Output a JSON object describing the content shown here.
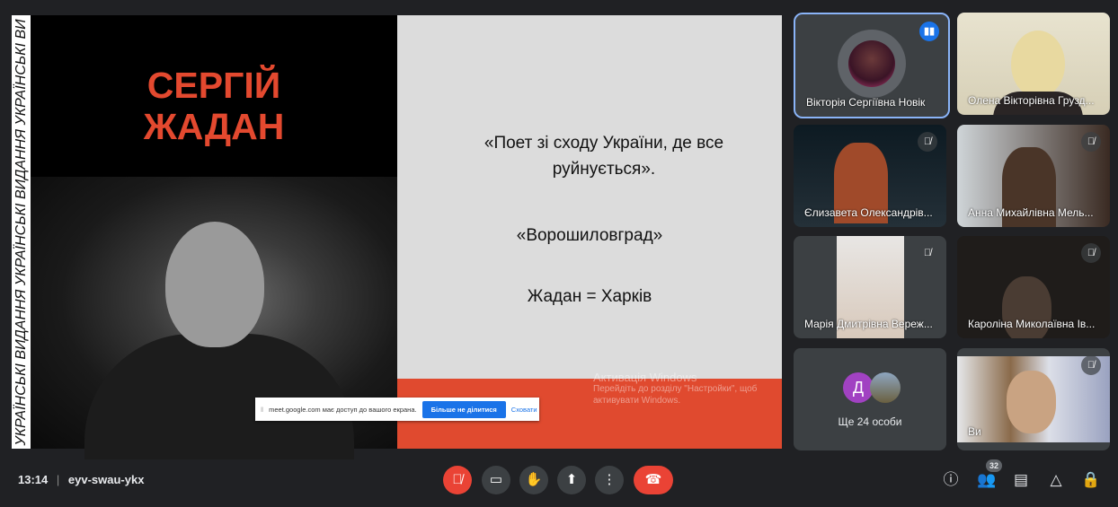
{
  "slide": {
    "strip_text": "УКРАЇНСЬКІ ВИДАННЯ УКРАЇНСЬКІ ВИДАННЯ УКРАЇНСЬКІ ВИ",
    "title_line1": "СЕРГІЙ",
    "title_line2": "ЖАДАН",
    "quote1": "«Поет зі сходу України, де все руйнується».",
    "quote2": "«Ворошиловград»",
    "quote3": "Жадан = Харків",
    "accent": "#e04a2f"
  },
  "watermark": {
    "title": "Активація Windows",
    "line": "Перейдіть до розділу \"Настройки\", щоб активувати Windows."
  },
  "share_bar": {
    "text": "meet.google.com має доступ до вашого екрана.",
    "stop_label": "Більше не ділитися",
    "hide_label": "Сховати"
  },
  "participants": [
    {
      "name": "Вікторія Сергіївна Новік",
      "speaking": true
    },
    {
      "name": "Олена Вікторівна Грузд...",
      "muted": false
    },
    {
      "name": "Єлизавета Олександрів...",
      "muted": true
    },
    {
      "name": "Анна Михайлівна Мель...",
      "muted": true
    },
    {
      "name": "Марія Дмитрівна Вереж...",
      "muted": true
    },
    {
      "name": "Кароліна Миколаївна Ів...",
      "muted": true
    },
    {
      "name": "Ще 24 особи",
      "avatar_letter": "Д"
    },
    {
      "name": "Ви",
      "muted": true
    }
  ],
  "bottom": {
    "time": "13:14",
    "separator": "|",
    "meeting_code": "eyv-swau-ykx",
    "people_count": "32"
  }
}
